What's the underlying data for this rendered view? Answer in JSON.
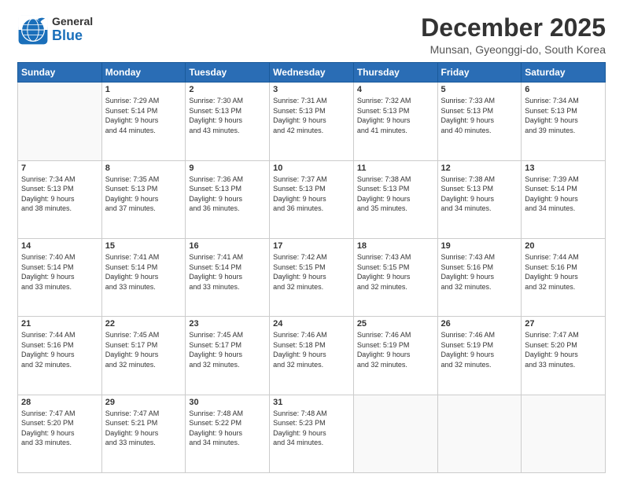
{
  "logo": {
    "general": "General",
    "blue": "Blue"
  },
  "title": "December 2025",
  "subtitle": "Munsan, Gyeonggi-do, South Korea",
  "days_of_week": [
    "Sunday",
    "Monday",
    "Tuesday",
    "Wednesday",
    "Thursday",
    "Friday",
    "Saturday"
  ],
  "weeks": [
    [
      {
        "day": "",
        "info": ""
      },
      {
        "day": "1",
        "info": "Sunrise: 7:29 AM\nSunset: 5:14 PM\nDaylight: 9 hours\nand 44 minutes."
      },
      {
        "day": "2",
        "info": "Sunrise: 7:30 AM\nSunset: 5:13 PM\nDaylight: 9 hours\nand 43 minutes."
      },
      {
        "day": "3",
        "info": "Sunrise: 7:31 AM\nSunset: 5:13 PM\nDaylight: 9 hours\nand 42 minutes."
      },
      {
        "day": "4",
        "info": "Sunrise: 7:32 AM\nSunset: 5:13 PM\nDaylight: 9 hours\nand 41 minutes."
      },
      {
        "day": "5",
        "info": "Sunrise: 7:33 AM\nSunset: 5:13 PM\nDaylight: 9 hours\nand 40 minutes."
      },
      {
        "day": "6",
        "info": "Sunrise: 7:34 AM\nSunset: 5:13 PM\nDaylight: 9 hours\nand 39 minutes."
      }
    ],
    [
      {
        "day": "7",
        "info": "Sunrise: 7:34 AM\nSunset: 5:13 PM\nDaylight: 9 hours\nand 38 minutes."
      },
      {
        "day": "8",
        "info": "Sunrise: 7:35 AM\nSunset: 5:13 PM\nDaylight: 9 hours\nand 37 minutes."
      },
      {
        "day": "9",
        "info": "Sunrise: 7:36 AM\nSunset: 5:13 PM\nDaylight: 9 hours\nand 36 minutes."
      },
      {
        "day": "10",
        "info": "Sunrise: 7:37 AM\nSunset: 5:13 PM\nDaylight: 9 hours\nand 36 minutes."
      },
      {
        "day": "11",
        "info": "Sunrise: 7:38 AM\nSunset: 5:13 PM\nDaylight: 9 hours\nand 35 minutes."
      },
      {
        "day": "12",
        "info": "Sunrise: 7:38 AM\nSunset: 5:13 PM\nDaylight: 9 hours\nand 34 minutes."
      },
      {
        "day": "13",
        "info": "Sunrise: 7:39 AM\nSunset: 5:14 PM\nDaylight: 9 hours\nand 34 minutes."
      }
    ],
    [
      {
        "day": "14",
        "info": "Sunrise: 7:40 AM\nSunset: 5:14 PM\nDaylight: 9 hours\nand 33 minutes."
      },
      {
        "day": "15",
        "info": "Sunrise: 7:41 AM\nSunset: 5:14 PM\nDaylight: 9 hours\nand 33 minutes."
      },
      {
        "day": "16",
        "info": "Sunrise: 7:41 AM\nSunset: 5:14 PM\nDaylight: 9 hours\nand 33 minutes."
      },
      {
        "day": "17",
        "info": "Sunrise: 7:42 AM\nSunset: 5:15 PM\nDaylight: 9 hours\nand 32 minutes."
      },
      {
        "day": "18",
        "info": "Sunrise: 7:43 AM\nSunset: 5:15 PM\nDaylight: 9 hours\nand 32 minutes."
      },
      {
        "day": "19",
        "info": "Sunrise: 7:43 AM\nSunset: 5:16 PM\nDaylight: 9 hours\nand 32 minutes."
      },
      {
        "day": "20",
        "info": "Sunrise: 7:44 AM\nSunset: 5:16 PM\nDaylight: 9 hours\nand 32 minutes."
      }
    ],
    [
      {
        "day": "21",
        "info": "Sunrise: 7:44 AM\nSunset: 5:16 PM\nDaylight: 9 hours\nand 32 minutes."
      },
      {
        "day": "22",
        "info": "Sunrise: 7:45 AM\nSunset: 5:17 PM\nDaylight: 9 hours\nand 32 minutes."
      },
      {
        "day": "23",
        "info": "Sunrise: 7:45 AM\nSunset: 5:17 PM\nDaylight: 9 hours\nand 32 minutes."
      },
      {
        "day": "24",
        "info": "Sunrise: 7:46 AM\nSunset: 5:18 PM\nDaylight: 9 hours\nand 32 minutes."
      },
      {
        "day": "25",
        "info": "Sunrise: 7:46 AM\nSunset: 5:19 PM\nDaylight: 9 hours\nand 32 minutes."
      },
      {
        "day": "26",
        "info": "Sunrise: 7:46 AM\nSunset: 5:19 PM\nDaylight: 9 hours\nand 32 minutes."
      },
      {
        "day": "27",
        "info": "Sunrise: 7:47 AM\nSunset: 5:20 PM\nDaylight: 9 hours\nand 33 minutes."
      }
    ],
    [
      {
        "day": "28",
        "info": "Sunrise: 7:47 AM\nSunset: 5:20 PM\nDaylight: 9 hours\nand 33 minutes."
      },
      {
        "day": "29",
        "info": "Sunrise: 7:47 AM\nSunset: 5:21 PM\nDaylight: 9 hours\nand 33 minutes."
      },
      {
        "day": "30",
        "info": "Sunrise: 7:48 AM\nSunset: 5:22 PM\nDaylight: 9 hours\nand 34 minutes."
      },
      {
        "day": "31",
        "info": "Sunrise: 7:48 AM\nSunset: 5:23 PM\nDaylight: 9 hours\nand 34 minutes."
      },
      {
        "day": "",
        "info": ""
      },
      {
        "day": "",
        "info": ""
      },
      {
        "day": "",
        "info": ""
      }
    ]
  ]
}
